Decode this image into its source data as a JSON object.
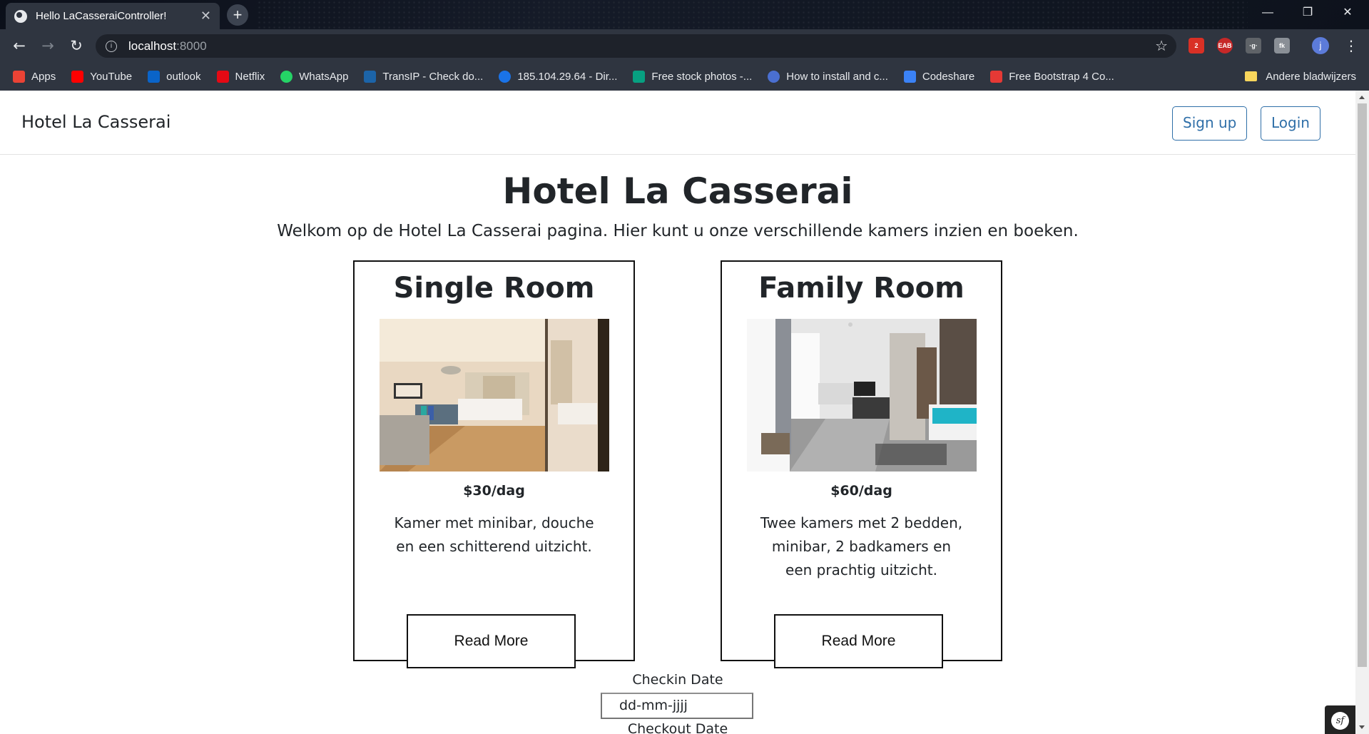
{
  "browser": {
    "tab_title": "Hello LaCasseraiController!",
    "tab_close": "✕",
    "new_tab": "+",
    "window_controls": {
      "minimize": "—",
      "restore": "❐",
      "close": "✕"
    },
    "address": {
      "host": "localhost",
      "port": ":8000"
    },
    "profile_initial": "j",
    "extensions": [
      {
        "name": "todo-extension-icon",
        "text": "2",
        "color": "#d93025"
      },
      {
        "name": "eab-extension-icon",
        "text": "EAB",
        "color": "#c62828"
      },
      {
        "name": "g-extension-icon",
        "text": "·g·",
        "color": "#5f6368"
      },
      {
        "name": "fk-extension-icon",
        "text": "fk",
        "color": "#8a8f96"
      }
    ],
    "bookmarks": [
      {
        "label": "Apps",
        "icon": "apps-grid-icon",
        "color": "#ea4335"
      },
      {
        "label": "YouTube",
        "icon": "youtube-icon",
        "color": "#ff0000"
      },
      {
        "label": "outlook",
        "icon": "outlook-icon",
        "color": "#0a64c9"
      },
      {
        "label": "Netflix",
        "icon": "netflix-icon",
        "color": "#e50914"
      },
      {
        "label": "WhatsApp",
        "icon": "whatsapp-icon",
        "color": "#25d366"
      },
      {
        "label": "TransIP - Check do...",
        "icon": "transip-icon",
        "color": "#1c64a8"
      },
      {
        "label": "185.104.29.64 - Dir...",
        "icon": "globe-icon",
        "color": "#1a73e8"
      },
      {
        "label": "Free stock photos -...",
        "icon": "pexels-icon",
        "color": "#07a081"
      },
      {
        "label": "How to install and c...",
        "icon": "eye-icon",
        "color": "#4a6fd1"
      },
      {
        "label": "Codeshare",
        "icon": "codeshare-icon",
        "color": "#3b82f6"
      },
      {
        "label": "Free Bootstrap 4 Co...",
        "icon": "s-icon",
        "color": "#e53935"
      }
    ],
    "other_bookmarks": "Andere bladwijzers"
  },
  "navbar": {
    "brand": "Hotel La Casserai",
    "signup": "Sign up",
    "login": "Login"
  },
  "hero": {
    "title": "Hotel La Casserai",
    "subtitle": "Welkom op de Hotel La Casserai pagina. Hier kunt u onze verschillende kamers inzien en boeken."
  },
  "rooms": [
    {
      "title": "Single Room",
      "price": "$30/dag",
      "description": "Kamer met minibar, douche en een schitterend uitzicht.",
      "button": "Read More"
    },
    {
      "title": "Family Room",
      "price": "$60/dag",
      "description": "Twee kamers met 2 bedden, minibar, 2 badkamers en een prachtig uitzicht.",
      "button": "Read More"
    }
  ],
  "booking": {
    "checkin_label": "Checkin Date",
    "checkin_placeholder": "dd-mm-jjjj",
    "checkout_label": "Checkout Date"
  },
  "symfony_badge": "sf"
}
